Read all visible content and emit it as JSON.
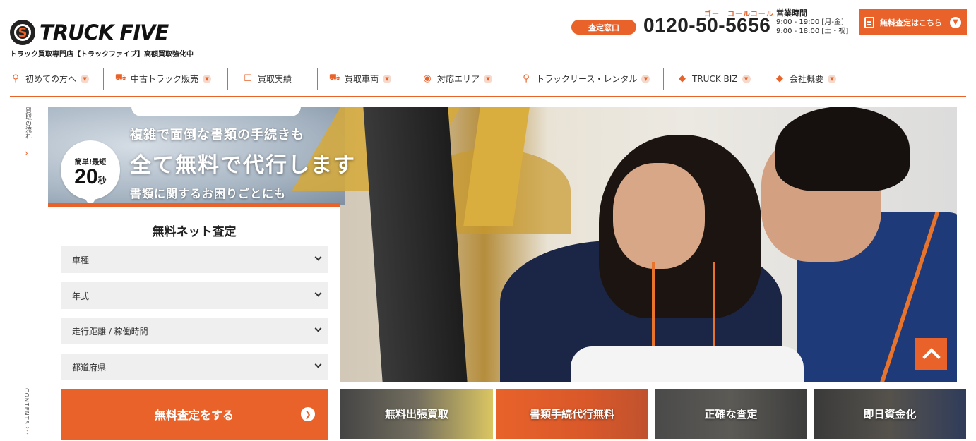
{
  "header": {
    "logo_text": "TRUCK FIVE",
    "logo_mark": "S",
    "tagline": "トラック買取専門店【トラックファイブ】高額買取強化中",
    "inquiry_label": "査定窓口",
    "phone_ruby": "ゴー　コールコール",
    "phone": "0120-50-5656",
    "hours_title": "営業時間",
    "hours_weekday": "9:00 - 19:00 [月-金]",
    "hours_weekend": "9:00 - 18:00 [土・祝]",
    "cta_label": "無料査定はこちら"
  },
  "nav": {
    "items": [
      {
        "label": "初めての方へ",
        "icon": "magnifier-doc-icon"
      },
      {
        "label": "中古トラック販売",
        "icon": "truck-icon"
      },
      {
        "label": "買取実績",
        "icon": "clipboard-icon"
      },
      {
        "label": "買取車両",
        "icon": "truck-icon"
      },
      {
        "label": "対応エリア",
        "icon": "map-pin-icon"
      },
      {
        "label": "トラックリース・レンタル",
        "icon": "magnifier-doc-icon"
      },
      {
        "label": "TRUCK BIZ",
        "icon": "tag-icon"
      },
      {
        "label": "会社概要",
        "icon": "tag-icon"
      }
    ]
  },
  "side": {
    "flow_label": "買取の流れ",
    "contents_label": "CONTENTS"
  },
  "hero": {
    "copy_line1": "複雑で面倒な書類の手続きも",
    "copy_line2": "全て無料で代行します",
    "copy_line3": "書類に関するお困りごとにも",
    "badge_top": "簡単!最短",
    "badge_number": "20",
    "badge_unit": "秒"
  },
  "form": {
    "title": "無料ネット査定",
    "selects": [
      {
        "value": "車種"
      },
      {
        "value": "年式"
      },
      {
        "value": "走行距離 / 稼働時間"
      },
      {
        "value": "都道府県"
      }
    ],
    "submit_label": "無料査定をする"
  },
  "tiles": [
    {
      "label": "無料出張買取"
    },
    {
      "label": "書類手続代行無料"
    },
    {
      "label": "正確な査定"
    },
    {
      "label": "即日資金化"
    }
  ],
  "colors": {
    "accent": "#e8622a",
    "text": "#222222",
    "field_bg": "#efefef"
  }
}
